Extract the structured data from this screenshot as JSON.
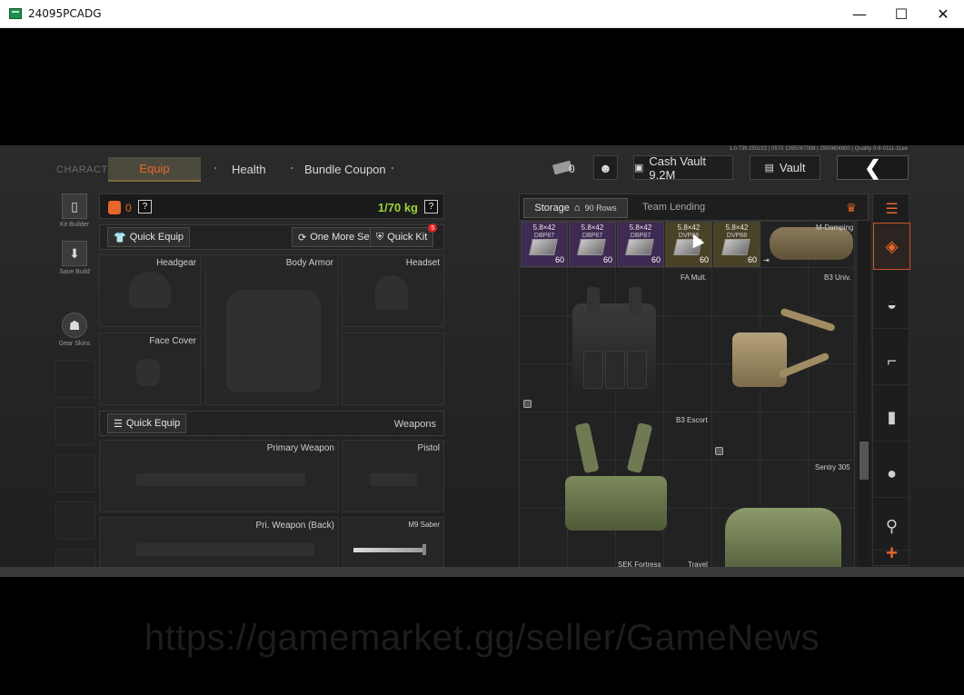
{
  "window": {
    "title": "24095PCADG",
    "minimize": "—",
    "maximize": "☐",
    "close": "✕"
  },
  "game": {
    "build_info": "1.0.739.250222 | 0572 1395007008 | 2500604800 | Quality 0-8-0111-11ee",
    "nav": {
      "character": "CHARACTER",
      "equip": "Equip",
      "health": "Health",
      "bundle_coupon": "Bundle Coupon"
    },
    "top_bar": {
      "cash_count": "0",
      "cash_vault": "Cash Vault 9.2M",
      "vault": "Vault",
      "back": "❮"
    },
    "tools": [
      {
        "label": "Kit Builder",
        "icon": "kit-builder-icon"
      },
      {
        "label": "Save Build",
        "icon": "save-build-icon"
      },
      {
        "label": "Gear Skins",
        "icon": "gear-skins-icon"
      }
    ],
    "character": {
      "bag_count": "0",
      "help": "?",
      "weight": "1/70 kg",
      "quick_equip": "Quick Equip",
      "one_more_set": "One More Set",
      "quick_kit": "Quick Kit",
      "quick_kit_badge": "5",
      "slots": {
        "headgear": "Headgear",
        "body_armor": "Body Armor",
        "headset": "Headset",
        "face_cover": "Face Cover",
        "quick_equip_2": "Quick Equip",
        "weapons": "Weapons",
        "primary_weapon": "Primary Weapon",
        "pistol": "Pistol",
        "pri_weapon_back": "Pri. Weapon (Back)",
        "melee": "M9 Saber"
      }
    },
    "storage": {
      "tab_storage": "Storage",
      "tab_rows": "90 Rows",
      "tab_team_lending": "Team Lending",
      "ammo": [
        {
          "caliber": "5.8×42",
          "code": "DBP87",
          "qty": "60",
          "tier": "purple"
        },
        {
          "caliber": "5.8×42",
          "code": "DBP87",
          "qty": "60",
          "tier": "purple"
        },
        {
          "caliber": "5.8×42",
          "code": "DBP87",
          "qty": "60",
          "tier": "purple"
        },
        {
          "caliber": "5.8×42",
          "code": "DVP88",
          "qty": "60",
          "tier": "gold"
        },
        {
          "caliber": "5.8×42",
          "code": "DVP88",
          "qty": "60",
          "tier": "gold"
        }
      ],
      "item_labels": {
        "m_damping": "M-Damping",
        "fa_mult": "FA Mult.",
        "b3_univ": "B3 Univ.",
        "b3_escort": "B3 Escort",
        "sentry_305": "Sentry 305",
        "sek_fortress": "SEK Fortress",
        "travel": "Travel"
      }
    },
    "categories": [
      {
        "icon": "backpack-stack-icon"
      },
      {
        "icon": "backpack-icon"
      },
      {
        "icon": "helmet-icon"
      },
      {
        "icon": "rifle-icon"
      },
      {
        "icon": "magazine-icon"
      },
      {
        "icon": "grenade-icon"
      },
      {
        "icon": "pistol-icon"
      },
      {
        "icon": "plus-icon",
        "label": "+"
      }
    ]
  },
  "watermark": "https://gamemarket.gg/seller/GameNews",
  "colors": {
    "accent": "#e8662b",
    "weight_green": "#9bd23c",
    "ammo_purple": "#3e2a52",
    "ammo_gold": "#4a4226"
  }
}
